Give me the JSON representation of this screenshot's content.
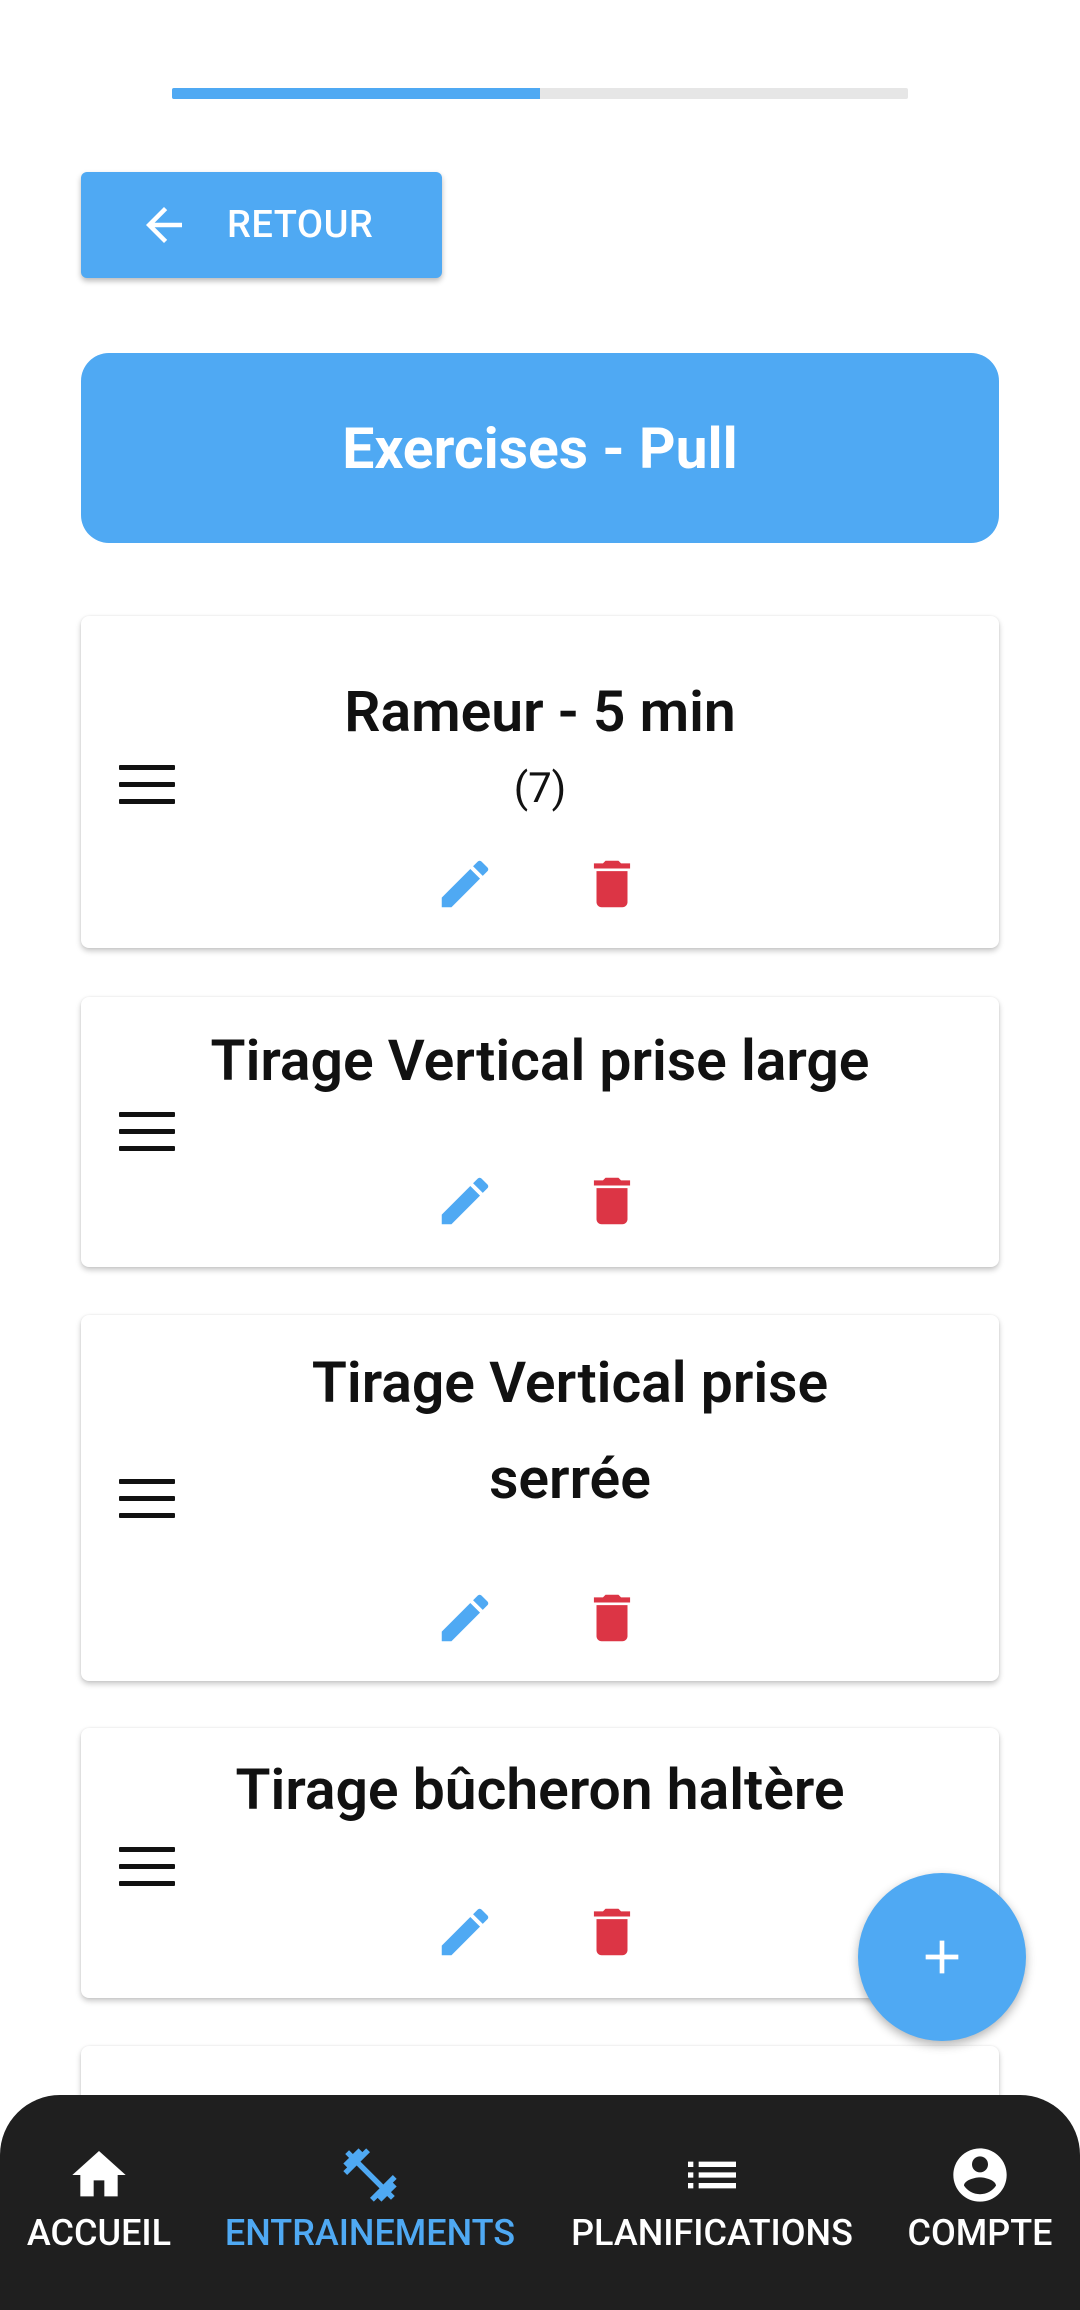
{
  "progress": {
    "fraction": 0.5
  },
  "back_button": {
    "label": "RETOUR"
  },
  "title": "Exercises - Pull",
  "exercises": [
    {
      "name": "Rameur - 5 min",
      "count": "(7)"
    },
    {
      "name": "Tirage Vertical prise large"
    },
    {
      "name": "Tirage Vertical prise serrée"
    },
    {
      "name": "Tirage bûcheron haltère"
    }
  ],
  "icons": {
    "back": "arrow-left-icon",
    "drag": "drag-handle-icon",
    "edit": "pencil-icon",
    "delete": "trash-icon",
    "add": "plus-icon"
  },
  "bottom_nav": {
    "items": [
      {
        "label": "ACCUEIL",
        "icon": "home-icon"
      },
      {
        "label": "ENTRAINEMENTS",
        "icon": "dumbbell-icon",
        "active": true
      },
      {
        "label": "PLANIFICATIONS",
        "icon": "list-icon"
      },
      {
        "label": "COMPTE",
        "icon": "account-icon"
      }
    ]
  },
  "colors": {
    "primary": "#4fa9f3",
    "delete": "#dc3545",
    "nav_background": "#1f1f1f"
  }
}
